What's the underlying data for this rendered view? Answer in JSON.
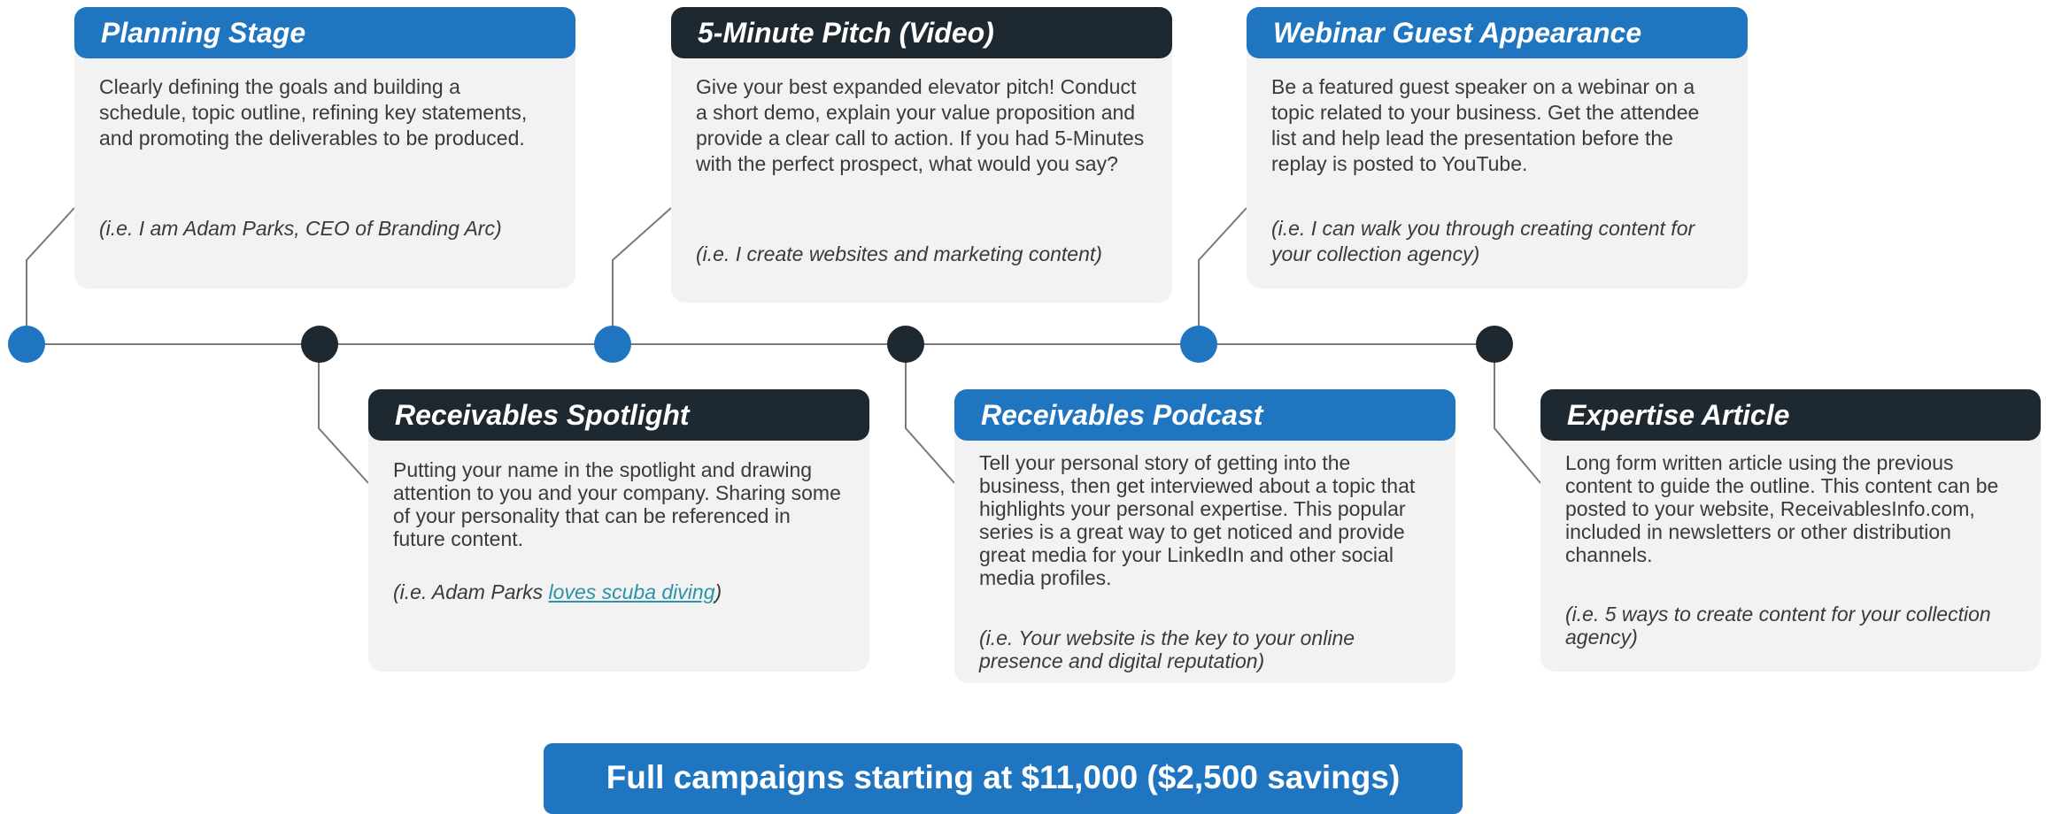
{
  "cards": [
    {
      "title": "Planning Stage",
      "body": "Clearly defining the goals and building a schedule, topic outline, refining key statements, and promoting the deliverables to be produced.",
      "example": "(i.e. I am Adam Parks, CEO of Branding Arc)"
    },
    {
      "title": "5-Minute Pitch (Video)",
      "body": "Give your best expanded elevator pitch! Conduct a short demo, explain your value proposition and provide a clear call to action. If you had 5-Minutes with the perfect prospect, what would you say?",
      "example": "(i.e. I create websites and marketing content)"
    },
    {
      "title": "Webinar Guest Appearance",
      "body": "Be a featured guest speaker on a webinar on a topic related to your business. Get the attendee list and help lead the presentation before the replay is posted to YouTube.",
      "example": "(i.e. I can walk you through creating content for your collection agency)"
    },
    {
      "title": "Receivables Spotlight",
      "body": "Putting your name in the spotlight and drawing attention to you and your company. Sharing some of your personality that can be referenced in future content.",
      "example_prefix": "(i.e. Adam Parks ",
      "example_link": "loves scuba diving",
      "example_suffix": ")"
    },
    {
      "title": "Receivables Podcast",
      "body": "Tell your personal story of getting into the business, then get interviewed about a topic that highlights your personal expertise. This popular series is a great way to get noticed and provide great media for your LinkedIn and other social media profiles.",
      "example": "(i.e. Your website is the key to your online presence and digital reputation)"
    },
    {
      "title": "Expertise Article",
      "body": "Long form written article using the previous content to guide the outline. This content can be posted to your website, ReceivablesInfo.com, included in newsletters or other distribution channels.",
      "example": "(i.e. 5 ways to create content for your collection agency)"
    }
  ],
  "cta": {
    "label": "Full campaigns starting at $11,000 ($2,500 savings)"
  },
  "colors": {
    "accent_blue": "#1f75c0",
    "dark_navy": "#1e2830",
    "card_bg": "#f2f2f2",
    "timeline": "#7a7a7a",
    "link": "#2a93a8"
  }
}
